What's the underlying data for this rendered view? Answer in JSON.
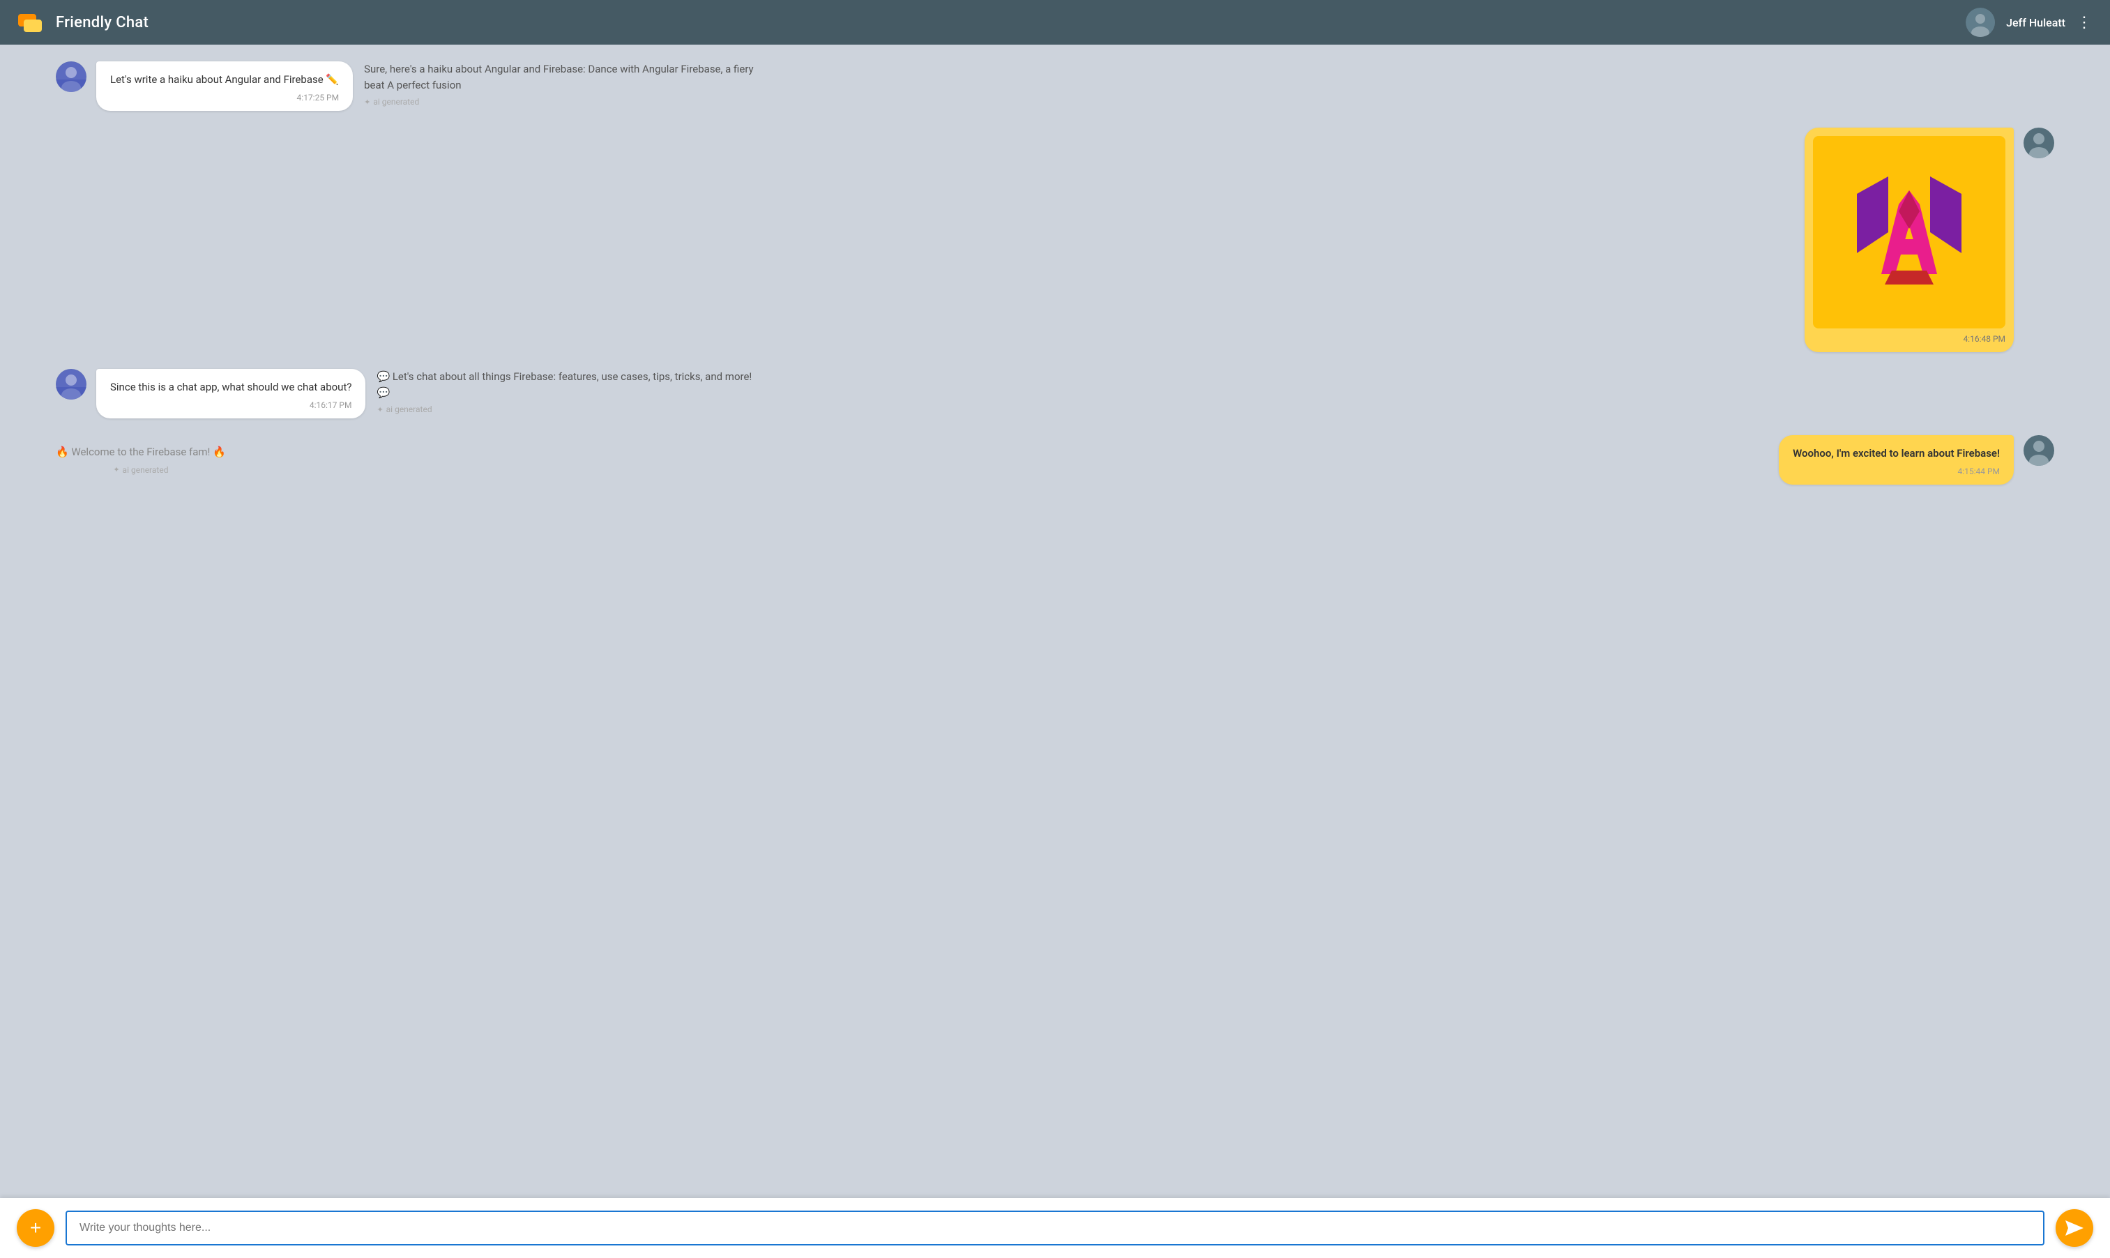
{
  "header": {
    "app_title": "Friendly Chat",
    "user_name": "Jeff Huleatt",
    "more_icon": "⋮"
  },
  "messages": [
    {
      "id": "msg1",
      "type": "incoming_with_ai",
      "avatar": "user1",
      "text": "Let's write a haiku about Angular and Firebase ✏️",
      "time": "4:17:25 PM",
      "ai_response": "Sure, here's a haiku about Angular and Firebase: Dance with Angular Firebase, a fiery beat A perfect fusion",
      "ai_label": "ai generated"
    },
    {
      "id": "msg2",
      "type": "outgoing_image",
      "avatar": "user2",
      "time": "4:16:48 PM"
    },
    {
      "id": "msg3",
      "type": "incoming_with_ai",
      "avatar": "user1",
      "text": "Since this is a chat app, what should we chat about?",
      "time": "4:16:17 PM",
      "ai_response": "💬 Let's chat about all things Firebase: features, use cases, tips, tricks, and more! 💬",
      "ai_label": "ai generated"
    },
    {
      "id": "msg4",
      "type": "welcome_with_outgoing",
      "welcome_text": "🔥 Welcome to the Firebase fam! 🔥",
      "welcome_label": "ai generated",
      "outgoing_text": "Woohoo, I'm excited to learn about Firebase!",
      "outgoing_time": "4:15:44 PM",
      "avatar": "user2"
    }
  ],
  "input": {
    "placeholder": "Write your thoughts here..."
  },
  "buttons": {
    "add_label": "+",
    "send_label": "➤"
  },
  "colors": {
    "header_bg": "#455a64",
    "chat_bg": "#cdd3dc",
    "outgoing_bubble": "#ffd54f",
    "incoming_bubble": "#ffffff",
    "accent": "#ffa000",
    "input_border": "#1976d2"
  }
}
